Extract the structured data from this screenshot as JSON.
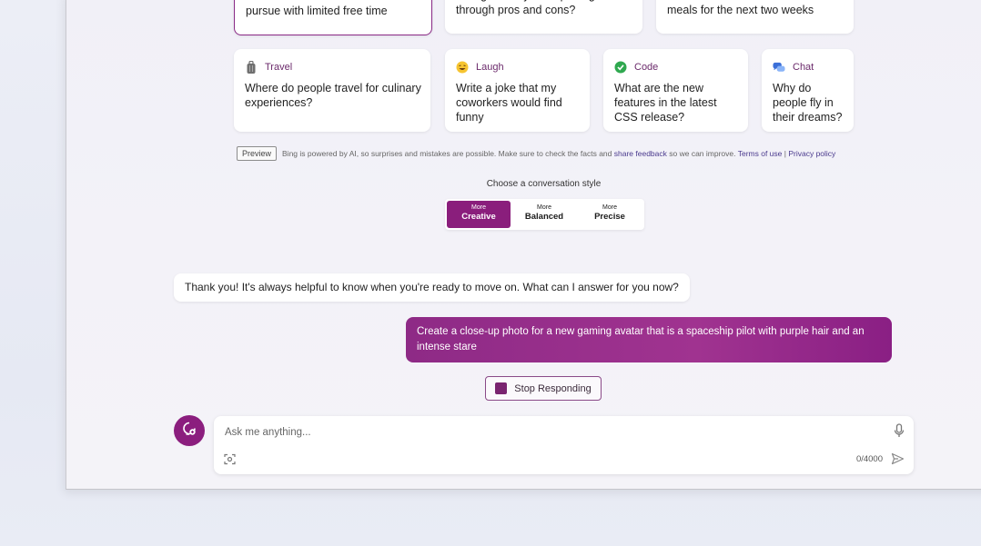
{
  "suggestions_top": [
    {
      "text": "pursue with limited free time"
    },
    {
      "text": "change. Can you help me go through pros and cons?"
    },
    {
      "text": "meals for the next two weeks"
    }
  ],
  "suggestions": [
    {
      "category": "Travel",
      "icon": "luggage-icon",
      "text": "Where do people travel for culinary experiences?"
    },
    {
      "category": "Laugh",
      "icon": "laughing-emoji-icon",
      "text": "Write a joke that my coworkers would find funny"
    },
    {
      "category": "Code",
      "icon": "checkmark-code-icon",
      "text": "What are the new features in the latest CSS release?"
    },
    {
      "category": "Chat",
      "icon": "chat-bubbles-icon",
      "text": "Why do people fly in their dreams?"
    }
  ],
  "disclaimer": {
    "badge": "Preview",
    "text": "Bing is powered by AI, so surprises and mistakes are possible. Make sure to check the facts and",
    "feedback_link": "share feedback",
    "text_after": "so we can improve.",
    "terms_link": "Terms of use",
    "separator": "|",
    "privacy_link": "Privacy policy"
  },
  "conversation_style": {
    "label": "Choose a conversation style",
    "options": [
      {
        "small": "More",
        "large": "Creative",
        "active": true
      },
      {
        "small": "More",
        "large": "Balanced",
        "active": false
      },
      {
        "small": "More",
        "large": "Precise",
        "active": false
      }
    ]
  },
  "messages": {
    "bot": "Thank you! It's always helpful to know when you're ready to move on. What can I answer for you now?",
    "user": "Create a close-up photo for a new gaming avatar that is a spaceship pilot with purple hair and an intense stare"
  },
  "stop_button": "Stop Responding",
  "input": {
    "placeholder": "Ask me anything...",
    "value": "",
    "counter": "0/4000"
  },
  "colors": {
    "accent": "#8a1e7c",
    "user_bubble": "#9a2e8c",
    "background": "#f2f1f7"
  }
}
